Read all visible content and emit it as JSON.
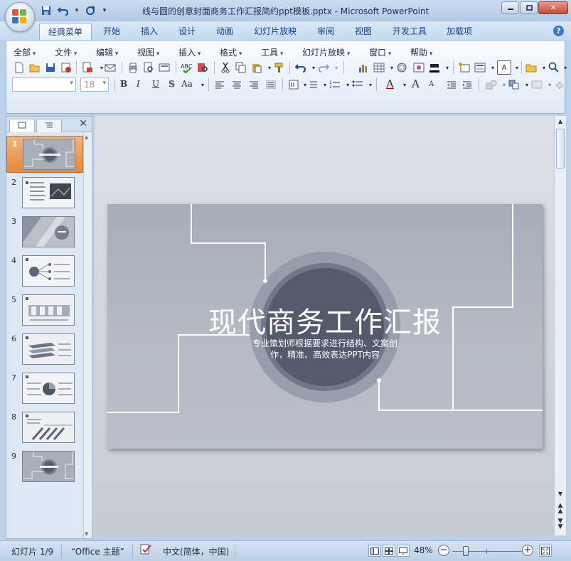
{
  "window": {
    "title": "线与圆的创意封面商务工作汇报简约ppt模板.pptx - Microsoft PowerPoint",
    "qat_customize": "▾"
  },
  "tabs": [
    {
      "label": "经典菜单",
      "active": true
    },
    {
      "label": "开始"
    },
    {
      "label": "插入"
    },
    {
      "label": "设计"
    },
    {
      "label": "动画"
    },
    {
      "label": "幻灯片放映"
    },
    {
      "label": "审阅"
    },
    {
      "label": "视图"
    },
    {
      "label": "开发工具"
    },
    {
      "label": "加载项"
    }
  ],
  "menus": [
    "全部",
    "文件",
    "编辑",
    "视图",
    "插入",
    "格式",
    "工具",
    "幻灯片放映",
    "窗口",
    "帮助"
  ],
  "toolbar": {
    "font_name": "",
    "font_size": "18",
    "bold": "B",
    "italic": "I",
    "underline": "U",
    "shadow": "S",
    "case": "Aa",
    "font_color_letter": "A",
    "grow": "A",
    "shrink": "A",
    "text_box": "A"
  },
  "left_panel": {
    "tab_slides_icon": "slides-tab-icon",
    "tab_outline_icon": "outline-tab-icon",
    "close": "✕",
    "thumbnails": [
      {
        "num": "1",
        "selected": true
      },
      {
        "num": "2"
      },
      {
        "num": "3"
      },
      {
        "num": "4"
      },
      {
        "num": "5"
      },
      {
        "num": "6"
      },
      {
        "num": "7"
      },
      {
        "num": "8"
      },
      {
        "num": "9"
      }
    ]
  },
  "slide": {
    "title": "现代商务工作汇报",
    "subtitle_line1": "专业策划师根据要求进行结构、文案创",
    "subtitle_line2": "作，精准、高效表达PPT内容"
  },
  "statusbar": {
    "slide_info": "幻灯片 1/9",
    "theme": "“Office 主题”",
    "language": "中文(简体，中国)",
    "zoom": "48%",
    "zoom_fraction": 0.17
  },
  "colors": {
    "accent": "#e5893f",
    "slide_bg": "#b2b7c1",
    "circle_inner": "#525a6b"
  }
}
